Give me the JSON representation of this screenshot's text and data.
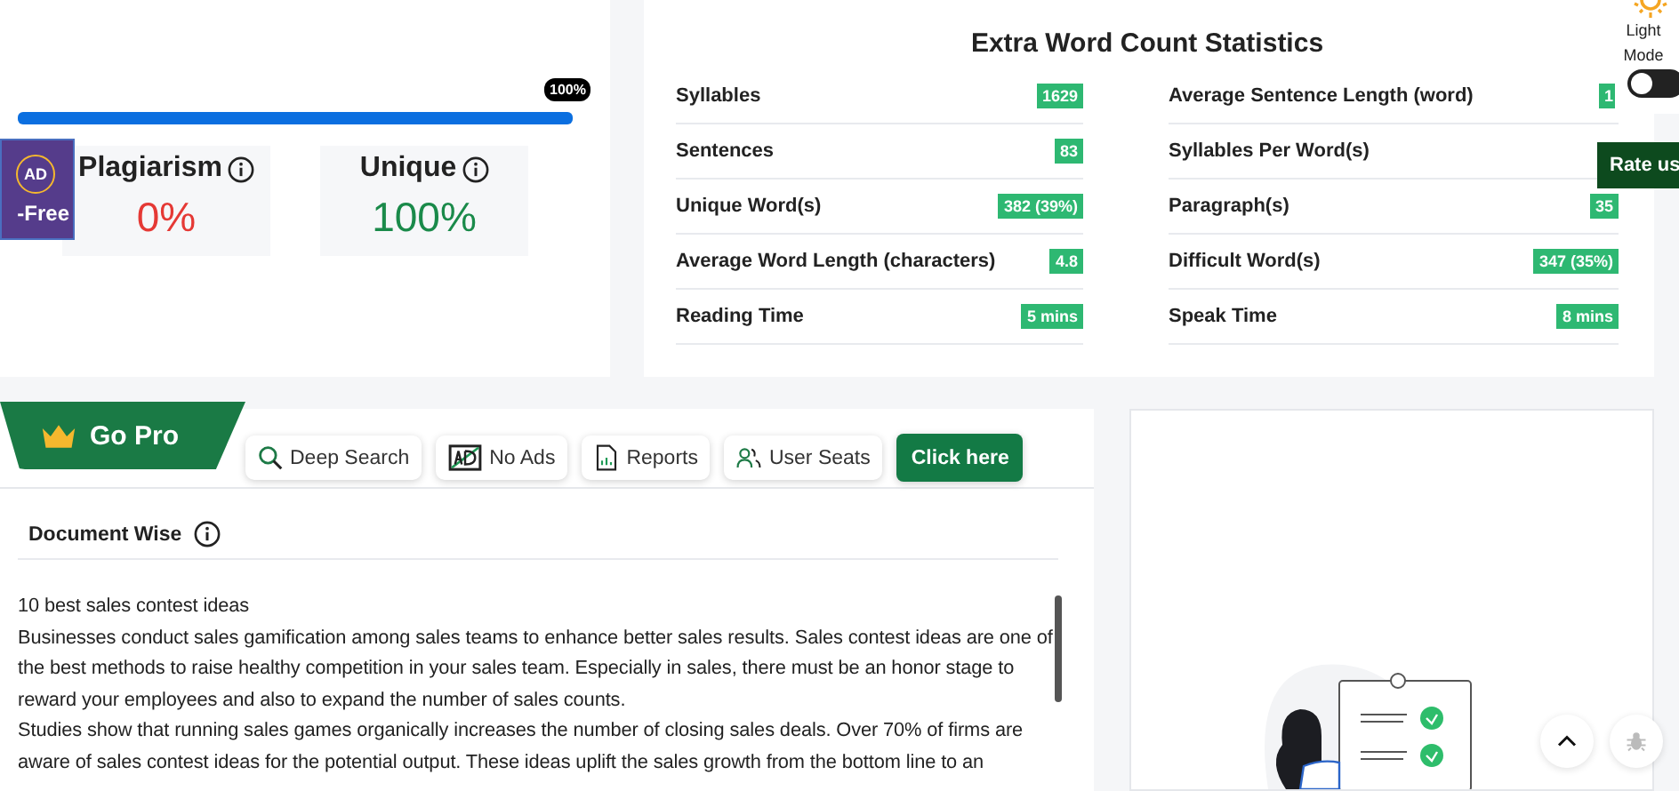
{
  "progress": {
    "level": 1,
    "label": "100%"
  },
  "ad_badge": {
    "icon_text": "AD",
    "label": "-Free"
  },
  "scores": [
    {
      "label": "Plagiarism",
      "value": "0%",
      "kind": "bad"
    },
    {
      "label": "Unique",
      "value": "100%",
      "kind": "good"
    }
  ],
  "stats": {
    "title": "Extra Word Count Statistics",
    "columns": [
      [
        {
          "label": "Syllables",
          "value": "1629"
        },
        {
          "label": "Sentences",
          "value": "83"
        },
        {
          "label": "Unique Word(s)",
          "value": "382 (39%)"
        },
        {
          "label": "Average Word Length (characters)",
          "value": "4.8"
        },
        {
          "label": "Reading Time",
          "value": "5 mins"
        }
      ],
      [
        {
          "label": "Average Sentence Length (word)",
          "value": "1"
        },
        {
          "label": "Syllables Per Word(s)"
        },
        {
          "label": "Paragraph(s)",
          "value": "35"
        },
        {
          "label": "Difficult Word(s)",
          "value": "347 (35%)"
        },
        {
          "label": "Speak Time",
          "value": "8 mins"
        }
      ]
    ]
  },
  "theme": {
    "label_1": "Light",
    "label_2": "Mode",
    "on": false
  },
  "rate_button": "Rate us",
  "pro": {
    "tab": "Go Pro",
    "features": [
      {
        "label": "Deep Search",
        "kind": "search"
      },
      {
        "label": "No Ads",
        "kind": "noads"
      },
      {
        "label": "Reports",
        "kind": "report"
      },
      {
        "label": "User Seats",
        "kind": "users"
      }
    ],
    "cta": "Click here"
  },
  "document": {
    "title": "Document Wise",
    "paragraphs": [
      "10 best sales contest ideas",
      "Businesses conduct sales gamification among sales teams to enhance better sales results. Sales contest ideas are one of the best methods to raise healthy competition in your sales team. Especially in sales, there must be an honor stage to reward your employees and also to expand the number of sales counts.",
      "Studies show that running sales games organically increases the number of closing sales deals. Over 70% of firms are aware of sales contest ideas for the potential output. These ideas uplift the sales growth from the bottom line to an"
    ]
  }
}
